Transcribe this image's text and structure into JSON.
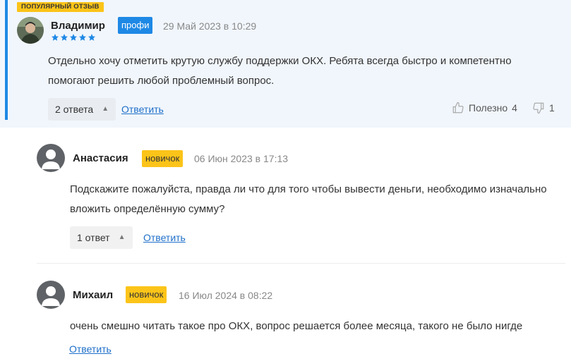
{
  "review": {
    "popular_label": "ПОПУЛЯРНЫЙ ОТЗЫВ",
    "author": "Владимир",
    "badge": "профи",
    "date": "29 Май 2023 в 10:29",
    "rating": 5,
    "text": "Отдельно хочу отметить крутую службу поддержки ОКХ. Ребята всегда быстро и компетентно помогают решить любой проблемный вопрос.",
    "replies_label": "2 ответа",
    "reply_link": "Ответить",
    "helpful_label": "Полезно",
    "helpful_count": "4",
    "unhelpful_count": "1"
  },
  "replies": [
    {
      "author": "Анастасия",
      "badge": "новичок",
      "date": "06 Июн 2023 в 17:13",
      "text": "Подскажите пожалуйста, правда ли что для того чтобы вывести деньги, необходимо изначально вложить определённую сумму?",
      "replies_label": "1 ответ",
      "reply_link": "Ответить"
    },
    {
      "author": "Михаил",
      "badge": "новичок",
      "date": "16 Июл 2024 в 08:22",
      "text": "очень смешно читать такое про ОКХ, вопрос решается более месяца, такого не было нигде",
      "reply_link": "Ответить"
    }
  ],
  "colors": {
    "accent": "#1e88e5",
    "badge_yellow": "#fcc419",
    "star": "#1e88e5",
    "link": "#1e6fc9"
  }
}
